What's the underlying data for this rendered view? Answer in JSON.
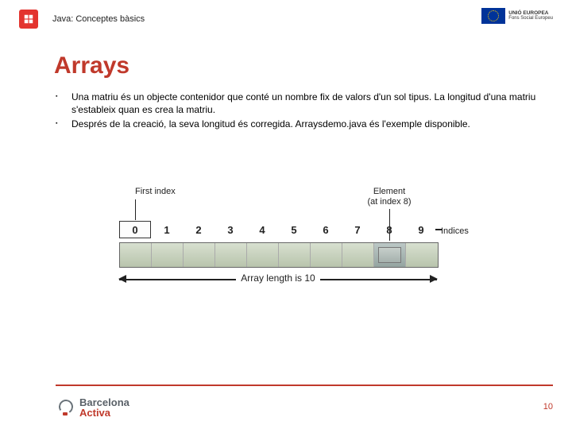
{
  "header": {
    "course_title": "Java: Conceptes bàsics",
    "eu_badge": {
      "line1": "UNIÓ EUROPEA",
      "line2": "Fons Social Europeu"
    }
  },
  "title": "Arrays",
  "bullets": [
    "Una matriu és un objecte contenidor que conté un nombre fix de valors d'un sol tipus. La longitud d'una matriu s'estableix quan es crea la matriu.",
    "Després de la creació, la seva longitud és corregida. Arraysdemo.java és l'exemple disponible."
  ],
  "diagram": {
    "first_index_label": "First index",
    "element_label_l1": "Element",
    "element_label_l2": "(at index 8)",
    "indices_label": "Indices",
    "indices": [
      "0",
      "1",
      "2",
      "3",
      "4",
      "5",
      "6",
      "7",
      "8",
      "9"
    ],
    "highlight_index": 8,
    "length_label": "Array length is 10"
  },
  "footer": {
    "brand_line1": "Barcelona",
    "brand_line2": "Activa",
    "page_number": "10"
  }
}
